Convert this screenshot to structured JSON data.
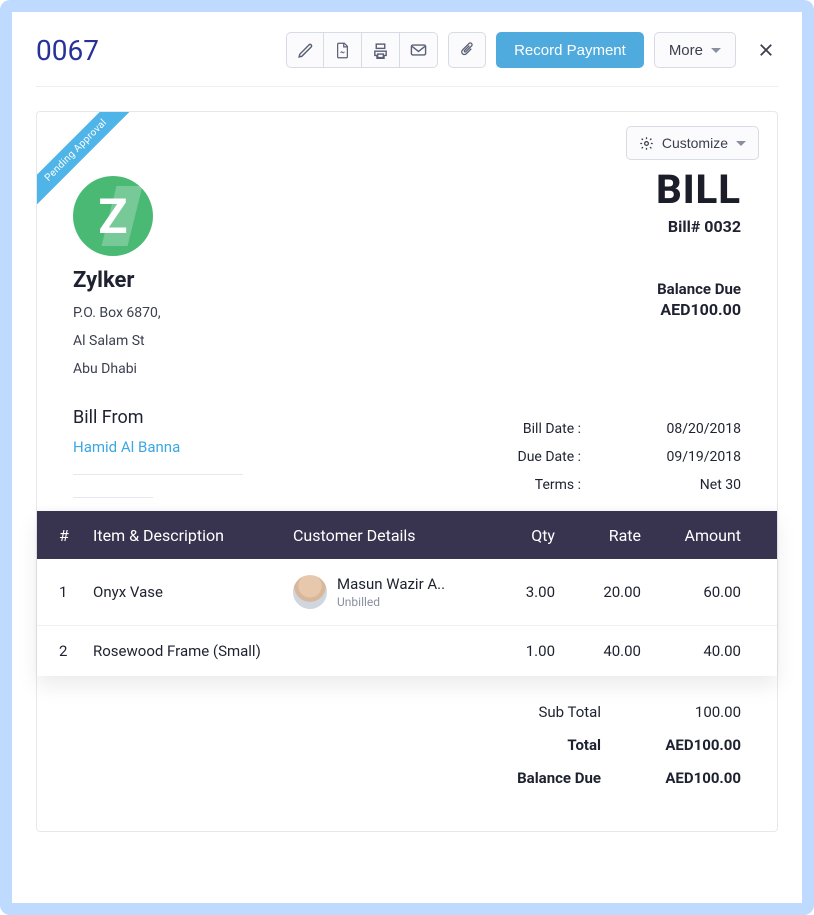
{
  "page": {
    "id": "0067"
  },
  "toolbar": {
    "record_payment": "Record Payment",
    "more": "More"
  },
  "ribbon": {
    "status": "Pending Approval"
  },
  "customize": {
    "label": "Customize"
  },
  "company": {
    "logo_letter": "Z",
    "name": "Zylker",
    "address1": "P.O. Box 6870,",
    "address2": "Al Salam St",
    "address3": "Abu Dhabi"
  },
  "bill": {
    "title": "BILL",
    "number_label": "Bill# 0032",
    "balance_due_label": "Balance Due",
    "balance_due_value": "AED100.00"
  },
  "from": {
    "label": "Bill From",
    "vendor": "Hamid Al Banna"
  },
  "meta": {
    "bill_date_label": "Bill Date :",
    "bill_date_value": "08/20/2018",
    "due_date_label": "Due Date :",
    "due_date_value": "09/19/2018",
    "terms_label": "Terms :",
    "terms_value": "Net 30"
  },
  "columns": {
    "idx": "#",
    "item": "Item & Description",
    "customer": "Customer Details",
    "qty": "Qty",
    "rate": "Rate",
    "amount": "Amount"
  },
  "lines": [
    {
      "idx": "1",
      "item": "Onyx Vase",
      "customer": "Masun Wazir A..",
      "customer_status": "Unbilled",
      "has_customer": true,
      "qty": "3.00",
      "rate": "20.00",
      "amount": "60.00"
    },
    {
      "idx": "2",
      "item": "Rosewood Frame (Small)",
      "customer": "",
      "customer_status": "",
      "has_customer": false,
      "qty": "1.00",
      "rate": "40.00",
      "amount": "40.00"
    }
  ],
  "totals": {
    "subtotal_label": "Sub Total",
    "subtotal_value": "100.00",
    "total_label": "Total",
    "total_value": "AED100.00",
    "balance_label": "Balance Due",
    "balance_value": "AED100.00"
  }
}
